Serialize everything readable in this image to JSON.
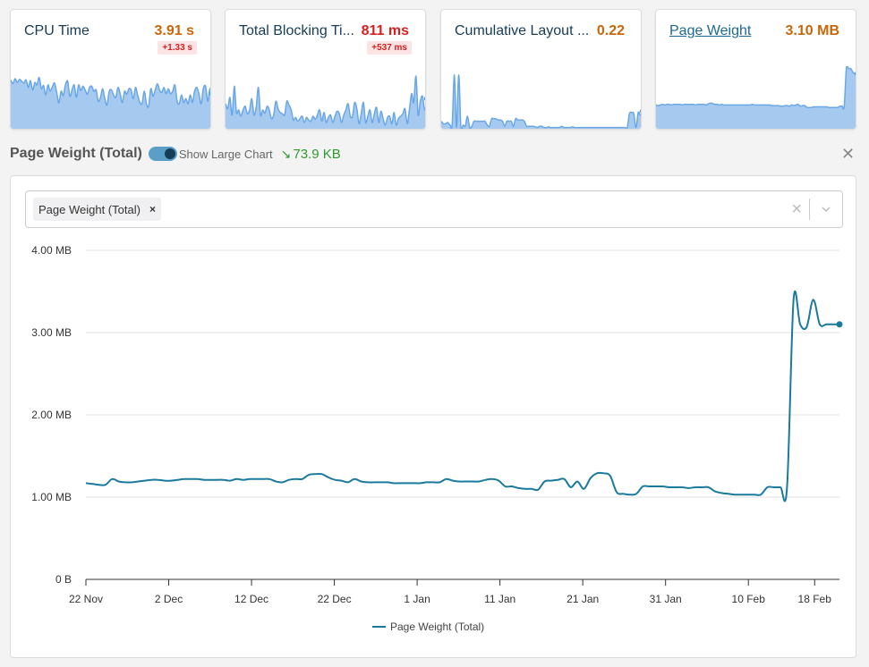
{
  "cards": [
    {
      "title": "CPU Time",
      "value": "3.91 s",
      "delta": "+1.33 s",
      "value_color": "#c8660a",
      "link": false,
      "spark": [
        0.78,
        0.72,
        0.8,
        0.74,
        0.79,
        0.76,
        0.73,
        0.78,
        0.66,
        0.77,
        0.62,
        0.74,
        0.7,
        0.82,
        0.64,
        0.69,
        0.54,
        0.7,
        0.6,
        0.67,
        0.73,
        0.58,
        0.41,
        0.6,
        0.53,
        0.7,
        0.76,
        0.52,
        0.62,
        0.7,
        0.5,
        0.7,
        0.61,
        0.68,
        0.62,
        0.55,
        0.66,
        0.68,
        0.6,
        0.62,
        0.44,
        0.5,
        0.64,
        0.48,
        0.38,
        0.6,
        0.62,
        0.54,
        0.5,
        0.66,
        0.56,
        0.42,
        0.6,
        0.55,
        0.64,
        0.62,
        0.48,
        0.66,
        0.54,
        0.42,
        0.4,
        0.6,
        0.4,
        0.36,
        0.64,
        0.52,
        0.62,
        0.72,
        0.62,
        0.58,
        0.66,
        0.56,
        0.64,
        0.56,
        0.6,
        0.7,
        0.44,
        0.4,
        0.54,
        0.42,
        0.48,
        0.4,
        0.54,
        0.42,
        0.6,
        0.66,
        0.56,
        0.4,
        0.64,
        0.68,
        0.44,
        0.64,
        0.56
      ]
    },
    {
      "title": "Total Blocking Ti...",
      "value": "811 ms",
      "delta": "+537 ms",
      "value_color": "#d61f1f",
      "link": false,
      "spark": [
        0.4,
        0.32,
        0.5,
        0.22,
        0.68,
        0.26,
        0.3,
        0.2,
        0.3,
        0.36,
        0.24,
        0.3,
        0.48,
        0.22,
        0.34,
        0.66,
        0.22,
        0.3,
        0.25,
        0.36,
        0.3,
        0.16,
        0.22,
        0.44,
        0.32,
        0.26,
        0.24,
        0.22,
        0.44,
        0.38,
        0.3,
        0.14,
        0.18,
        0.12,
        0.16,
        0.2,
        0.1,
        0.18,
        0.14,
        0.12,
        0.2,
        0.15,
        0.22,
        0.3,
        0.12,
        0.26,
        0.1,
        0.18,
        0.22,
        0.1,
        0.2,
        0.28,
        0.24,
        0.1,
        0.22,
        0.3,
        0.4,
        0.2,
        0.2,
        0.42,
        0.32,
        0.08,
        0.24,
        0.42,
        0.1,
        0.2,
        0.3,
        0.1,
        0.24,
        0.34,
        0.1,
        0.28,
        0.16,
        0.06,
        0.18,
        0.2,
        0.08,
        0.26,
        0.06,
        0.16,
        0.2,
        0.24,
        0.32,
        0.08,
        0.3,
        0.56,
        0.42,
        0.84,
        0.22,
        0.44,
        0.52,
        0.3,
        0.48
      ]
    },
    {
      "title": "Cumulative Layout ...",
      "value": "0.22",
      "delta": null,
      "value_color": "#c8660a",
      "link": false,
      "spark": [
        0.12,
        0.08,
        0.08,
        0.1,
        0.06,
        0.06,
        0.86,
        0.02,
        0.86,
        0.02,
        0.06,
        0.04,
        0.2,
        0.02,
        0.04,
        0.12,
        0.12,
        0.12,
        0.12,
        0.12,
        0.12,
        0.06,
        0.04,
        0.16,
        0.16,
        0.16,
        0.14,
        0.14,
        0.12,
        0.04,
        0.12,
        0.12,
        0.12,
        0.04,
        0.16,
        0.14,
        0.14,
        0.14,
        0.12,
        0.04,
        0.04,
        0.04,
        0.04,
        0.03,
        0.02,
        0.04,
        0.04,
        0.02,
        0.02,
        0.03,
        0.02,
        0.02,
        0.02,
        0.02,
        0.02,
        0.04,
        0.02,
        0.02,
        0.02,
        0.02,
        0.03,
        0.02,
        0.02,
        0.02,
        0.02,
        0.02,
        0.02,
        0.02,
        0.02,
        0.02,
        0.02,
        0.02,
        0.02,
        0.02,
        0.02,
        0.02,
        0.02,
        0.02,
        0.02,
        0.02,
        0.02,
        0.02,
        0.02,
        0.02,
        0.02,
        0.02,
        0.24,
        0.26,
        0.24,
        0.02,
        0.26,
        0.22,
        0.28
      ]
    },
    {
      "title": "Page Weight",
      "value": "3.10 MB",
      "delta": null,
      "value_color": "#c8660a",
      "link": true,
      "spark": [
        0.38,
        0.37,
        0.38,
        0.39,
        0.38,
        0.39,
        0.39,
        0.38,
        0.39,
        0.39,
        0.39,
        0.39,
        0.38,
        0.39,
        0.39,
        0.39,
        0.39,
        0.39,
        0.38,
        0.39,
        0.39,
        0.39,
        0.39,
        0.38,
        0.4,
        0.41,
        0.4,
        0.39,
        0.39,
        0.38,
        0.39,
        0.38,
        0.38,
        0.38,
        0.38,
        0.38,
        0.38,
        0.38,
        0.38,
        0.38,
        0.38,
        0.38,
        0.38,
        0.38,
        0.39,
        0.38,
        0.38,
        0.38,
        0.38,
        0.38,
        0.38,
        0.38,
        0.38,
        0.37,
        0.37,
        0.37,
        0.37,
        0.36,
        0.36,
        0.37,
        0.37,
        0.36,
        0.38,
        0.37,
        0.38,
        0.39,
        0.36,
        0.37,
        0.37,
        0.34,
        0.34,
        0.34,
        0.35,
        0.35,
        0.35,
        0.35,
        0.35,
        0.35,
        0.35,
        0.34,
        0.34,
        0.34,
        0.34,
        0.34,
        0.36,
        0.36,
        0.36,
        0.98,
        0.96,
        0.96,
        0.9,
        0.88,
        0.88
      ]
    }
  ],
  "section": {
    "title": "Page Weight (Total)",
    "toggle_label": "Show Large Chart",
    "toggle_on": true,
    "trend_arrow": "↘",
    "trend_value": "73.9 KB",
    "trend_color": "#2e9a2e"
  },
  "selector": {
    "chips": [
      {
        "label": "Page Weight (Total)",
        "remove": "×"
      }
    ],
    "clear_icon": "×"
  },
  "chart_data": {
    "type": "line",
    "title": "",
    "xlabel": "",
    "ylabel": "",
    "ylim": [
      0,
      4
    ],
    "y_unit": "MB",
    "y_ticks": [
      {
        "value": 0,
        "label": "0 B"
      },
      {
        "value": 1,
        "label": "1.00 MB"
      },
      {
        "value": 2,
        "label": "2.00 MB"
      },
      {
        "value": 3,
        "label": "3.00 MB"
      },
      {
        "value": 4,
        "label": "4.00 MB"
      }
    ],
    "x_range_days": [
      0,
      91
    ],
    "x_ticks": [
      {
        "day": 0,
        "label": "22 Nov"
      },
      {
        "day": 10,
        "label": "2 Dec"
      },
      {
        "day": 20,
        "label": "12 Dec"
      },
      {
        "day": 30,
        "label": "22 Dec"
      },
      {
        "day": 40,
        "label": "1 Jan"
      },
      {
        "day": 50,
        "label": "11 Jan"
      },
      {
        "day": 60,
        "label": "21 Jan"
      },
      {
        "day": 70,
        "label": "31 Jan"
      },
      {
        "day": 80,
        "label": "10 Feb"
      },
      {
        "day": 88,
        "label": "18 Feb"
      }
    ],
    "grid": true,
    "legend": "bottom-center",
    "series": [
      {
        "name": "Page Weight (Total)",
        "color": "#1a7a9e",
        "values": [
          1.17,
          1.16,
          1.15,
          1.15,
          1.22,
          1.19,
          1.18,
          1.18,
          1.19,
          1.2,
          1.21,
          1.21,
          1.2,
          1.2,
          1.21,
          1.22,
          1.22,
          1.22,
          1.21,
          1.21,
          1.21,
          1.21,
          1.2,
          1.22,
          1.21,
          1.22,
          1.22,
          1.22,
          1.22,
          1.19,
          1.18,
          1.21,
          1.22,
          1.22,
          1.27,
          1.28,
          1.28,
          1.24,
          1.21,
          1.2,
          1.18,
          1.22,
          1.19,
          1.18,
          1.18,
          1.18,
          1.18,
          1.17,
          1.17,
          1.17,
          1.17,
          1.17,
          1.18,
          1.18,
          1.18,
          1.22,
          1.2,
          1.19,
          1.19,
          1.19,
          1.19,
          1.21,
          1.22,
          1.2,
          1.13,
          1.13,
          1.11,
          1.1,
          1.1,
          1.09,
          1.19,
          1.2,
          1.21,
          1.22,
          1.12,
          1.19,
          1.1,
          1.23,
          1.29,
          1.29,
          1.26,
          1.06,
          1.04,
          1.03,
          1.04,
          1.13,
          1.13,
          1.13,
          1.13,
          1.12,
          1.12,
          1.12,
          1.11,
          1.12,
          1.12,
          1.12,
          1.07,
          1.05,
          1.04,
          1.03,
          1.03,
          1.03,
          1.03,
          1.03,
          1.12,
          1.12,
          1.12,
          1.12,
          3.4,
          3.1,
          3.07,
          3.4,
          3.1,
          3.1,
          3.1,
          3.1
        ]
      }
    ],
    "last_point_marker": true
  }
}
